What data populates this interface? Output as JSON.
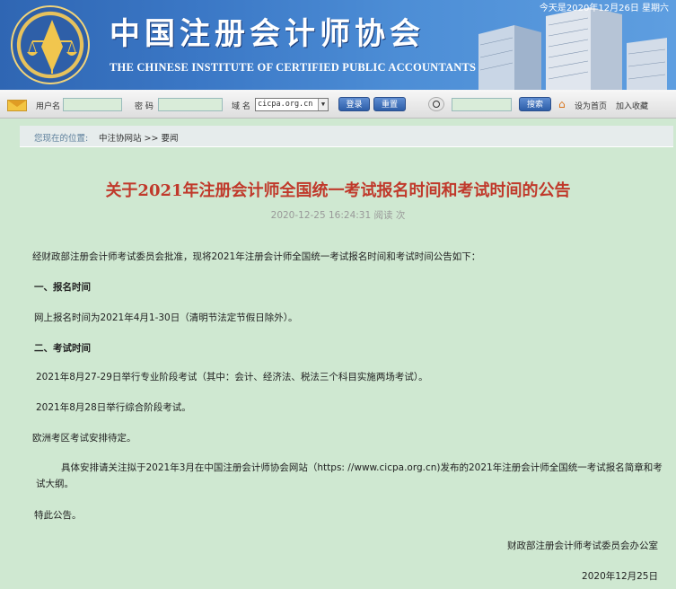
{
  "header": {
    "date_text": "今天是2020年12月26日 星期六",
    "cn_title": "中国注册会计师协会",
    "en_title": "THE CHINESE INSTITUTE OF CERTIFIED PUBLIC ACCOUNTANTS",
    "emblem_icon": "cicpa-emblem-icon"
  },
  "login": {
    "username_label": "用户名",
    "password_label": "密 码",
    "domain_label": "域 名",
    "domain_value": "cicpa.org.cn",
    "login_button": "登录",
    "reset_button": "重置",
    "search_button": "搜索",
    "set_home": "设为首页",
    "add_favorite": "加入收藏"
  },
  "breadcrumb": {
    "prefix": "您现在的位置:",
    "path": "中注协网站 >> 要闻"
  },
  "article": {
    "title": "关于2021年注册会计师全国统一考试报名时间和考试时间的公告",
    "meta": "2020-12-25 16:24:31  阅读 次",
    "paragraphs": {
      "intro": "经财政部注册会计师考试委员会批准，现将2021年注册会计师全国统一考试报名时间和考试时间公告如下：",
      "h1": "一、报名时间",
      "p1": "网上报名时间为2021年4月1-30日（清明节法定节假日除外）。",
      "h2": "二、考试时间",
      "p2": "2021年8月27-29日举行专业阶段考试（其中：会计、经济法、税法三个科目实施两场考试）。",
      "p3": "2021年8月28日举行综合阶段考试。",
      "p4": "欧洲考区考试安排待定。",
      "p5": "具体安排请关注拟于2021年3月在中国注册会计师协会网站（https: //www.cicpa.org.cn)发布的2021年注册会计师全国统一考试报名简章和考试大纲。",
      "p6": "特此公告。"
    },
    "signature": "财政部注册会计师考试委员会办公室",
    "sign_date": "2020年12月25日"
  }
}
